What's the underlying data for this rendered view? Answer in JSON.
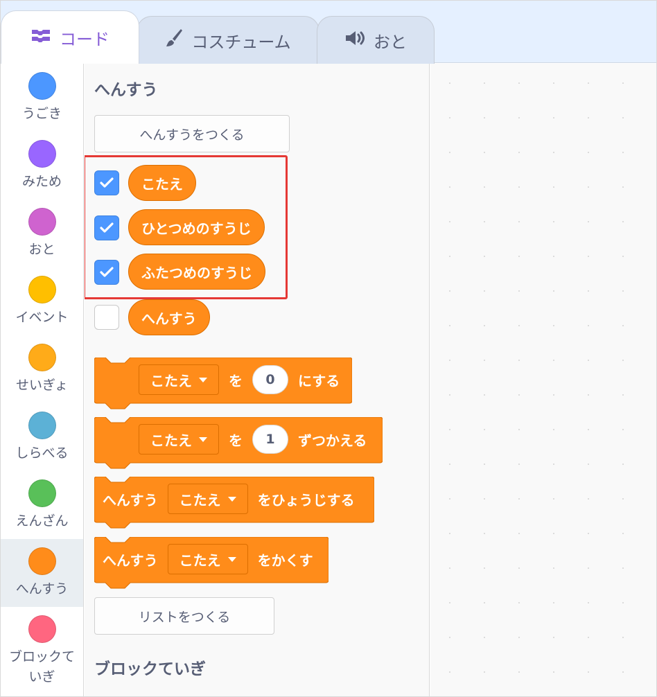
{
  "tabs": [
    {
      "label": "コード",
      "icon": "code-icon",
      "active": true
    },
    {
      "label": "コスチューム",
      "icon": "brush-icon",
      "active": false
    },
    {
      "label": "おと",
      "icon": "speaker-icon",
      "active": false
    }
  ],
  "categories": [
    {
      "label": "うごき",
      "color": "#4c97ff"
    },
    {
      "label": "みため",
      "color": "#9966ff"
    },
    {
      "label": "おと",
      "color": "#cf63cf"
    },
    {
      "label": "イベント",
      "color": "#ffbf00"
    },
    {
      "label": "せいぎょ",
      "color": "#ffab19"
    },
    {
      "label": "しらべる",
      "color": "#5cb1d6"
    },
    {
      "label": "えんざん",
      "color": "#59c059"
    },
    {
      "label": "へんすう",
      "color": "#ff8c1a",
      "selected": true
    },
    {
      "label": "ブロックていぎ",
      "color": "#ff6680"
    }
  ],
  "palette": {
    "section_variables": "へんすう",
    "make_variable_button": "へんすうをつくる",
    "variables": [
      {
        "name": "こたえ",
        "checked": true
      },
      {
        "name": "ひとつめのすうじ",
        "checked": true
      },
      {
        "name": "ふたつめのすうじ",
        "checked": true
      },
      {
        "name": "へんすう",
        "checked": false
      }
    ],
    "set_block": {
      "var": "こたえ",
      "particle": "を",
      "value": "0",
      "suffix": "にする"
    },
    "change_block": {
      "var": "こたえ",
      "particle": "を",
      "value": "1",
      "suffix": "ずつかえる"
    },
    "show_block": {
      "prefix": "へんすう",
      "var": "こたえ",
      "suffix": "をひょうじする"
    },
    "hide_block": {
      "prefix": "へんすう",
      "var": "こたえ",
      "suffix": "をかくす"
    },
    "make_list_button": "リストをつくる",
    "section_my_blocks": "ブロックていぎ"
  },
  "colors": {
    "variable_block": "#ff8c1a",
    "checkbox_on": "#4c97ff",
    "highlight": "#e53935",
    "code_tab_accent": "#855cd6"
  }
}
